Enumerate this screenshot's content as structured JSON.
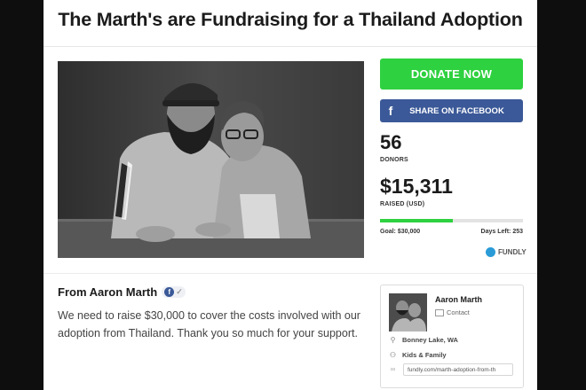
{
  "campaign": {
    "title": "The Marth's are Fundraising for a Thailand Adoption"
  },
  "actions": {
    "donate_label": "DONATE NOW",
    "share_label": "SHARE ON FACEBOOK",
    "share_icon": "f"
  },
  "stats": {
    "donors_count": "56",
    "donors_label": "DONORS",
    "raised_amount": "$15,311",
    "raised_label": "RAISED (USD)",
    "progress_fraction": 0.51,
    "goal": "Goal: $30,000",
    "days_left": "Days Left: 253"
  },
  "brand": {
    "name": "FUNDLY"
  },
  "story": {
    "from": "From Aaron Marth",
    "description": "We need to raise $30,000 to cover the costs involved with our adoption from Thailand. Thank you so much for your support."
  },
  "organizer": {
    "name": "Aaron Marth",
    "contact_label": "Contact",
    "location": "Bonney Lake, WA",
    "category": "Kids & Family",
    "url": "fundly.com/marth-adoption-from-th"
  },
  "colors": {
    "donate": "#2ed13f",
    "facebook": "#3b5998",
    "progress": "#2ed13f"
  }
}
